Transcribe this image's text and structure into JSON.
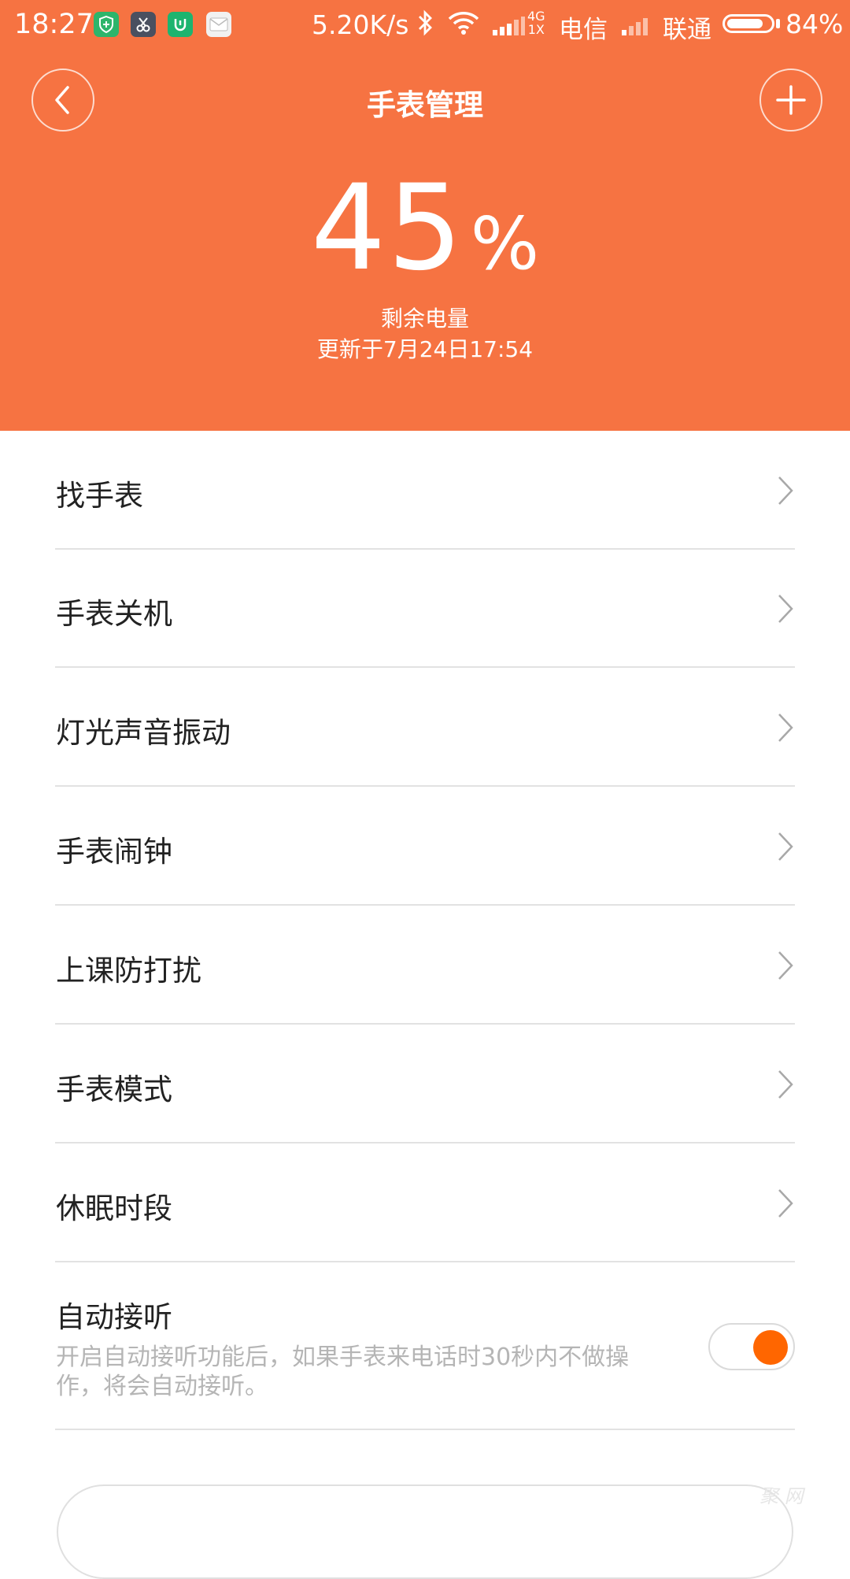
{
  "status_bar": {
    "time": "18:27",
    "net_speed": "5.20K/s",
    "carrier1": "电信",
    "carrier2": "联通",
    "battery_percent": "84%",
    "battery_level": 0.84,
    "network_type_top": "4G",
    "network_type_bottom": "1X",
    "icons": [
      "shield-app-icon",
      "scissors-app-icon",
      "mi-app-icon",
      "mail-icon",
      "bluetooth-icon",
      "wifi-icon",
      "signal-icon"
    ],
    "colors": {
      "shield_app": "#2DB56B",
      "scissors_app": "#4A5060",
      "mi_app": "#1DB46F"
    }
  },
  "header": {
    "title": "手表管理",
    "back_icon": "chevron-left-icon",
    "add_icon": "plus-icon",
    "battery_value": "45",
    "battery_unit": "%",
    "battery_label": "剩余电量",
    "updated_at": "更新于7月24日17:54",
    "color": "#F67342"
  },
  "menu": {
    "items": [
      {
        "label": "找手表"
      },
      {
        "label": "手表关机"
      },
      {
        "label": "灯光声音振动"
      },
      {
        "label": "手表闹钟"
      },
      {
        "label": "上课防打扰"
      },
      {
        "label": "手表模式"
      },
      {
        "label": "休眠时段"
      }
    ]
  },
  "auto_answer": {
    "label": "自动接听",
    "description": "开启自动接听功能后，如果手表来电话时30秒内不做操作，将会自动接听。",
    "enabled": true,
    "accent": "#FF6600"
  },
  "watermark": "聚 网"
}
